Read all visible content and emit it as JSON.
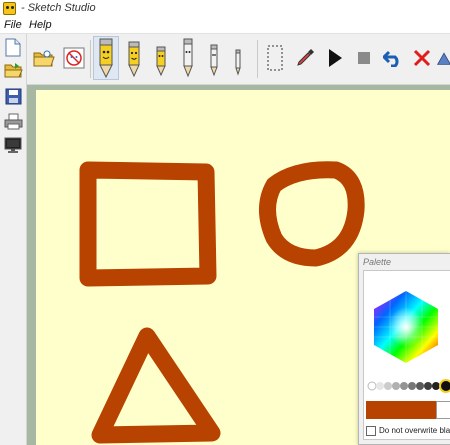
{
  "window": {
    "title": "- Sketch Studio"
  },
  "menu": {
    "file": "File",
    "help": "Help"
  },
  "toolbar": {
    "open_icon": "folder-open-icon",
    "clear_icon": "no-face-icon",
    "pencils": [
      "pencil-size-1-icon",
      "pencil-size-2-icon",
      "pencil-size-3-icon",
      "pencil-size-4-icon",
      "pencil-size-5-icon",
      "pencil-size-6-icon"
    ],
    "selected_pencil": 0,
    "select_icon": "dotted-rectangle-icon",
    "picker_icon": "eyedropper-icon",
    "play_icon": "play-icon",
    "stop_icon": "stop-icon",
    "undo_icon": "undo-icon",
    "delete_icon": "red-x-icon"
  },
  "left_toolbar": [
    "new-file-icon",
    "open-file-icon",
    "save-icon",
    "print-icon",
    "monitor-icon"
  ],
  "canvas": {
    "background": "#ffffcc",
    "stroke_color": "#b84200",
    "shapes": [
      "square",
      "circle",
      "triangle"
    ]
  },
  "palette": {
    "title": "Palette",
    "current_color": "#b84200",
    "checkbox_label": "Do not overwrite black",
    "checkbox_checked": false
  }
}
